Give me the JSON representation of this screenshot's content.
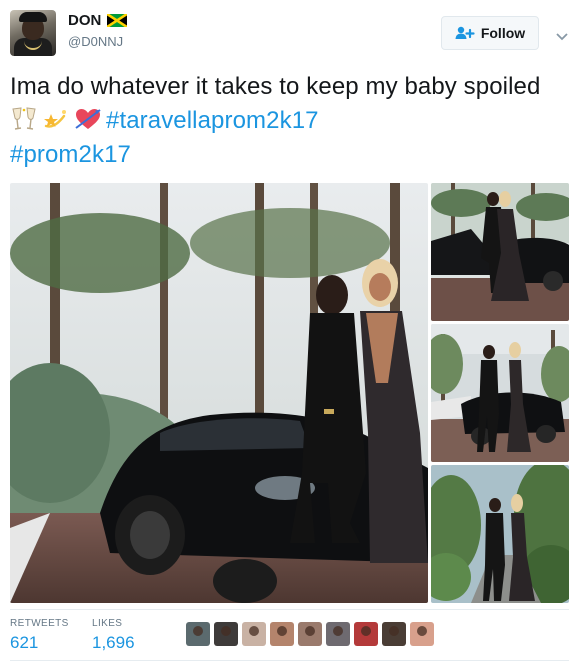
{
  "user": {
    "display_name": "DON",
    "handle": "@D0NNJ",
    "flag_icon": "jamaica-flag-icon"
  },
  "actions": {
    "follow_label": "Follow",
    "follow_icon": "add-user-icon",
    "more_icon": "chevron-down-icon"
  },
  "tweet": {
    "text_before": "Ima do whatever it takes to keep my baby spoiled ",
    "emojis": [
      "clinking-glasses-icon",
      "dizzy-star-icon",
      "heart-with-arrow-icon"
    ],
    "hashtag_1": "#taravellaprom2k17",
    "hashtag_2": "#prom2k17"
  },
  "media": {
    "photos": [
      "couple-with-black-car-photo",
      "couple-leaning-on-car-photo",
      "couple-standing-by-car-photo",
      "couple-on-garden-path-photo"
    ]
  },
  "stats": {
    "retweets_label": "RETWEETS",
    "retweets_value": "621",
    "likes_label": "LIKES",
    "likes_value": "1,696"
  },
  "likers": {
    "count": 9
  },
  "colors": {
    "link": "#1b95e0",
    "text": "#14171a",
    "muted": "#657786",
    "border": "#e1e8ed"
  }
}
